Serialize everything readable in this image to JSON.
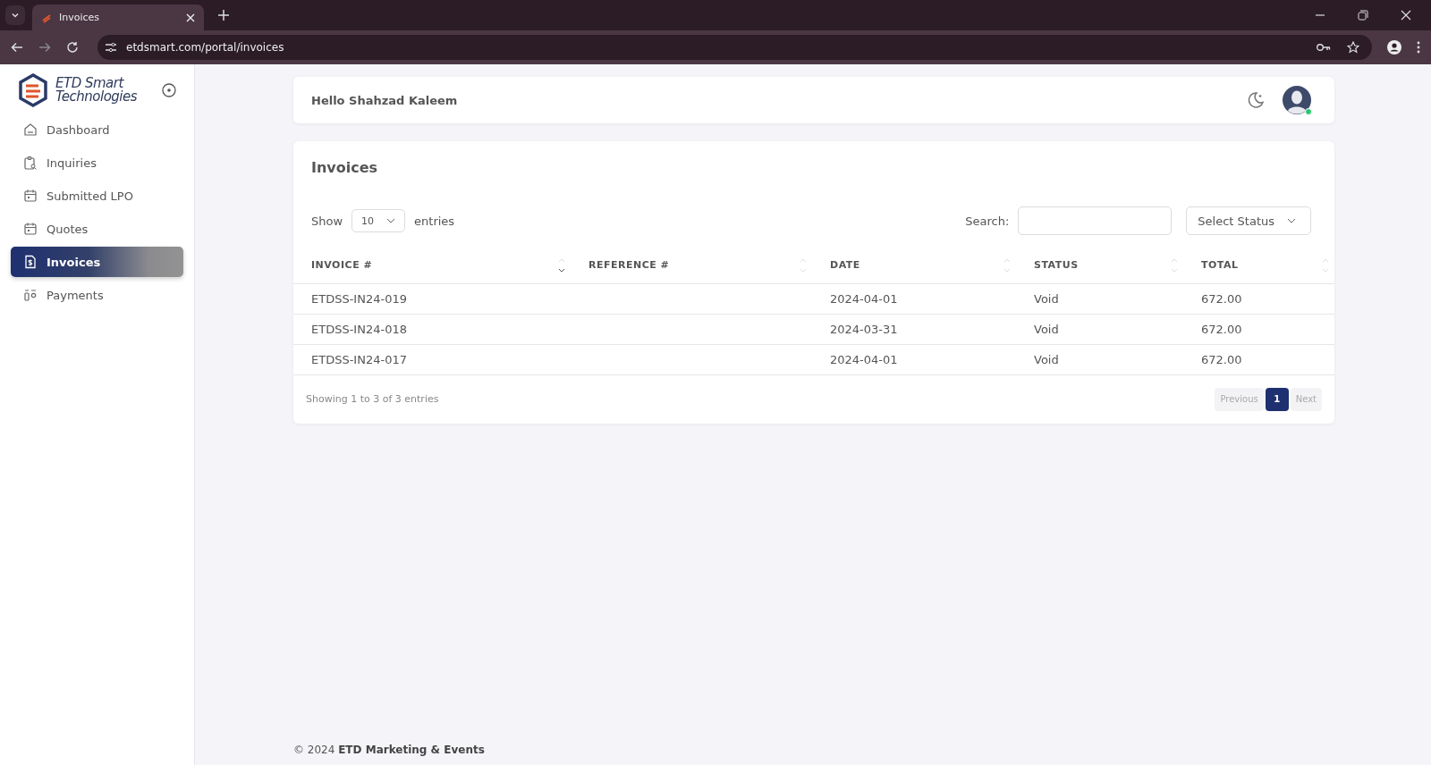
{
  "browser": {
    "tab_title": "Invoices",
    "url": "etdsmart.com/portal/invoices"
  },
  "sidebar": {
    "logo_lines": [
      "ETD Smart",
      "Technologies"
    ],
    "items": [
      {
        "label": "Dashboard",
        "kind": "home",
        "selected": false
      },
      {
        "label": "Inquiries",
        "kind": "clipboard",
        "selected": false
      },
      {
        "label": "Submitted LPO",
        "kind": "calendar",
        "selected": false
      },
      {
        "label": "Quotes",
        "kind": "calendar",
        "selected": false
      },
      {
        "label": "Invoices",
        "kind": "invoice",
        "selected": true
      },
      {
        "label": "Payments",
        "kind": "payments",
        "selected": false
      }
    ]
  },
  "header": {
    "greeting": "Hello Shahzad Kaleem",
    "online": true
  },
  "card": {
    "title": "Invoices",
    "show_label": "Show",
    "page_size": "10",
    "entries_label": "entries",
    "search_label": "Search:",
    "status_filter": "Select Status",
    "columns": [
      {
        "label": "INVOICE #",
        "sorted": true
      },
      {
        "label": "REFERENCE #",
        "sorted": false
      },
      {
        "label": "DATE",
        "sorted": false
      },
      {
        "label": "STATUS",
        "sorted": false
      },
      {
        "label": "TOTAL",
        "sorted": false
      }
    ],
    "rows": [
      [
        "ETDSS-IN24-019",
        "",
        "2024-04-01",
        "Void",
        "672.00"
      ],
      [
        "ETDSS-IN24-018",
        "",
        "2024-03-31",
        "Void",
        "672.00"
      ],
      [
        "ETDSS-IN24-017",
        "",
        "2024-04-01",
        "Void",
        "672.00"
      ]
    ],
    "info": "Showing 1 to 3 of 3 entries",
    "pagination": {
      "previous": "Previous",
      "pages": [
        {
          "label": "1",
          "selected": true
        }
      ],
      "next": "Next"
    }
  },
  "footer": "© 2024 **ETD Marketing & Events**"
}
